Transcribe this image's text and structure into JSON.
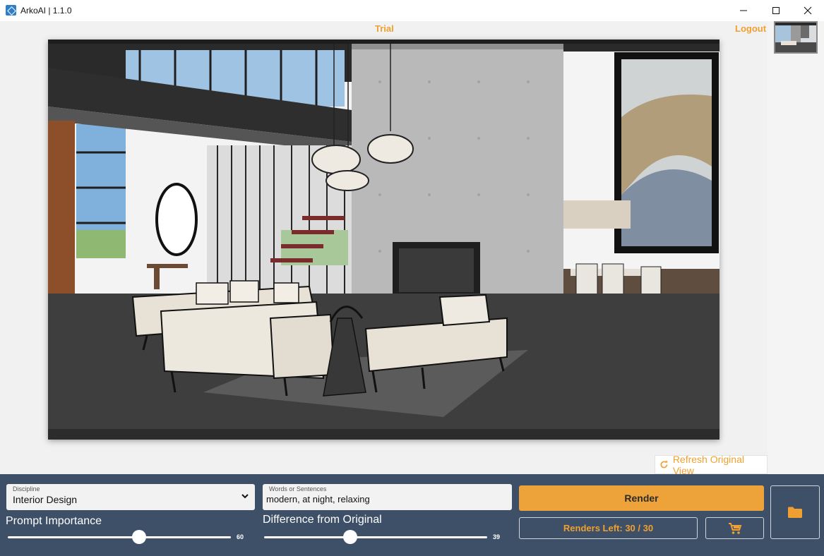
{
  "window": {
    "title": "ArkoAI | 1.1.0"
  },
  "header": {
    "trial_label": "Trial",
    "logout_label": "Logout"
  },
  "viewport": {
    "refresh_label": "Refresh Original View"
  },
  "controls": {
    "discipline": {
      "label": "Discipline",
      "value": "Interior Design"
    },
    "prompt": {
      "label": "Words or Sentences",
      "value": "modern, at night, relaxing"
    },
    "prompt_importance": {
      "label": "Prompt Importance",
      "value": "60"
    },
    "difference": {
      "label": "Difference from Original",
      "value": "39"
    },
    "render_label": "Render",
    "renders_left_label": "Renders Left: 30 / 30"
  },
  "colors": {
    "accent": "#f0a030",
    "panel": "#3d5068"
  },
  "icons": [
    "app-icon",
    "minimize-icon",
    "maximize-icon",
    "close-icon",
    "refresh-icon",
    "chevron-down-icon",
    "cart-icon",
    "folder-icon"
  ]
}
